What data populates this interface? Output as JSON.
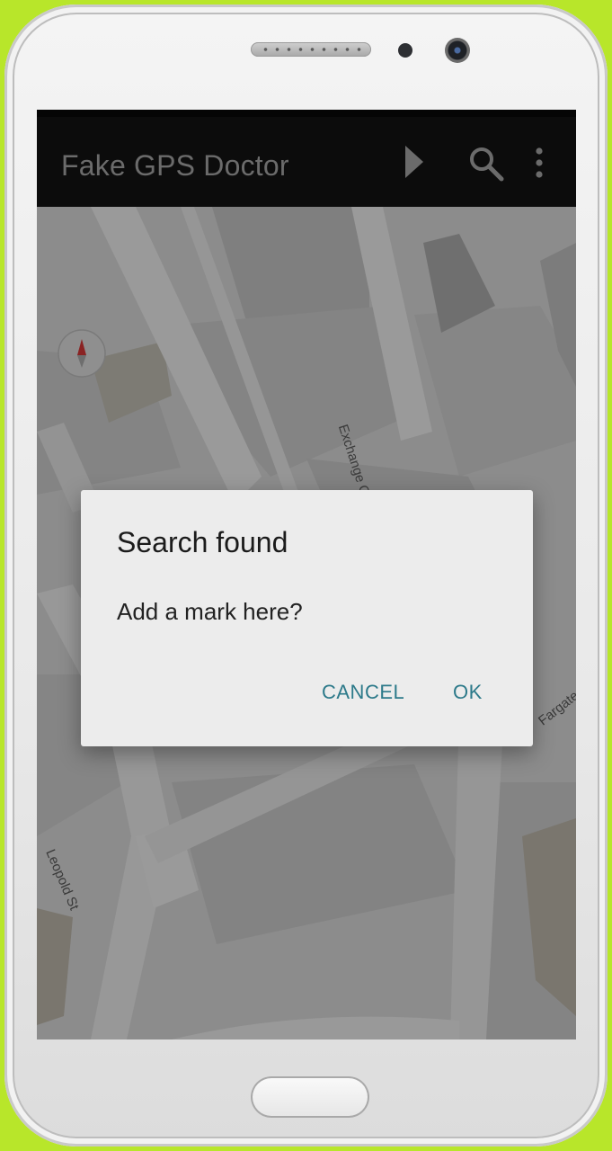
{
  "app": {
    "title": "Fake GPS Doctor"
  },
  "toolbar": {
    "icons": [
      "play-icon",
      "search-icon",
      "more-vert-icon"
    ]
  },
  "map": {
    "street_labels": {
      "exchange": "Exchange Gateway",
      "fargate": "Fargate",
      "leopold": "Leopold St"
    }
  },
  "dialog": {
    "title": "Search found",
    "message": "Add a mark here?",
    "cancel_label": "CANCEL",
    "ok_label": "OK"
  },
  "colors": {
    "accent": "#2d7a8a",
    "appbar": "#0c0c0c",
    "scrim_map": "#8e8e8e"
  }
}
